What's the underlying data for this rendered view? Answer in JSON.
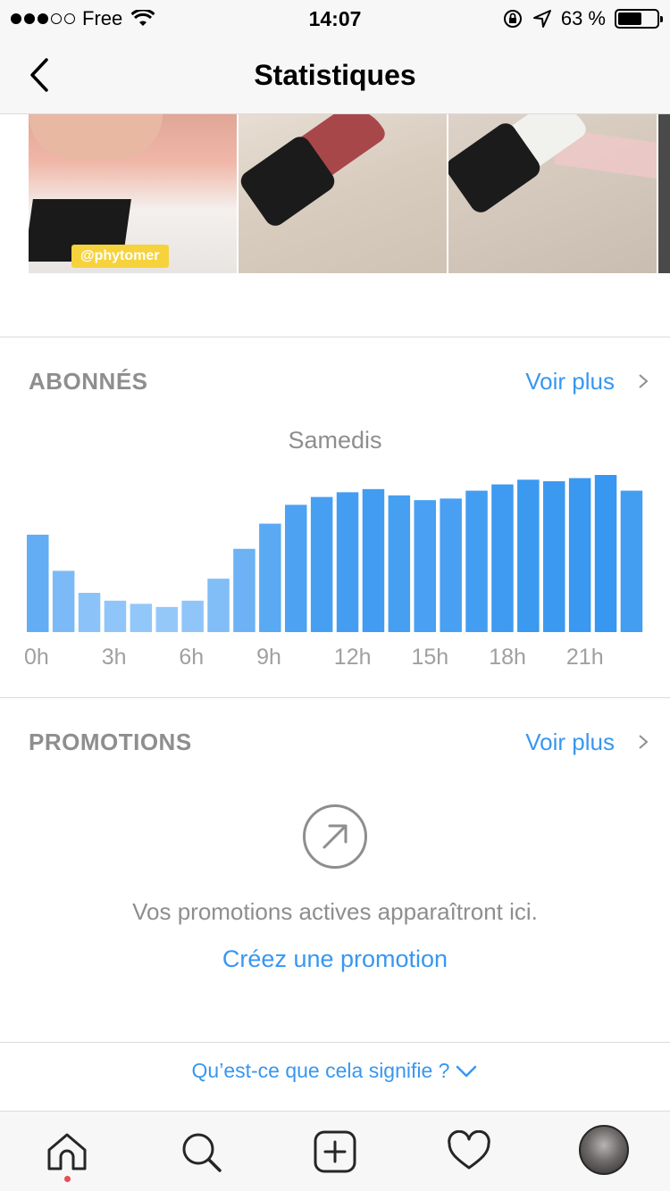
{
  "status_bar": {
    "carrier": "Free",
    "time": "14:07",
    "battery_percent_text": "63 %",
    "battery_level": 0.63,
    "signal_dots_filled": 3,
    "signal_dots_total": 5
  },
  "header": {
    "title": "Statistiques"
  },
  "photos": {
    "sticker_text": "@phytomer"
  },
  "followers_section": {
    "title": "ABONNÉS",
    "see_more": "Voir plus",
    "chart_title": "Samedis"
  },
  "chart_data": {
    "type": "bar",
    "title": "Samedis",
    "categories": [
      "0h",
      "1h",
      "2h",
      "3h",
      "4h",
      "5h",
      "6h",
      "7h",
      "8h",
      "9h",
      "10h",
      "11h",
      "12h",
      "13h",
      "14h",
      "15h",
      "16h",
      "17h",
      "18h",
      "19h",
      "20h",
      "21h",
      "22h",
      "23h"
    ],
    "tick_labels": [
      "0h",
      "3h",
      "6h",
      "9h",
      "12h",
      "15h",
      "18h",
      "21h"
    ],
    "values": [
      62,
      39,
      25,
      20,
      18,
      16,
      20,
      34,
      53,
      69,
      81,
      86,
      89,
      91,
      87,
      84,
      85,
      90,
      94,
      97,
      96,
      98,
      100,
      90
    ],
    "ylim": [
      0,
      100
    ],
    "colors": {
      "light": "#a6d1fb",
      "dark": "#3897f0"
    },
    "grid": false
  },
  "promotions_section": {
    "title": "PROMOTIONS",
    "see_more": "Voir plus",
    "empty_text": "Vos promotions actives apparaîtront ici.",
    "create_link": "Créez une promotion"
  },
  "footer_link": "Qu’est-ce que cela signifie ?",
  "colors": {
    "accent": "#3897f0",
    "muted": "#8e8e8e",
    "notification": "#ed4956"
  },
  "tab_bar": {
    "icons": [
      "home-icon",
      "search-icon",
      "add-icon",
      "heart-icon",
      "profile-avatar"
    ]
  }
}
